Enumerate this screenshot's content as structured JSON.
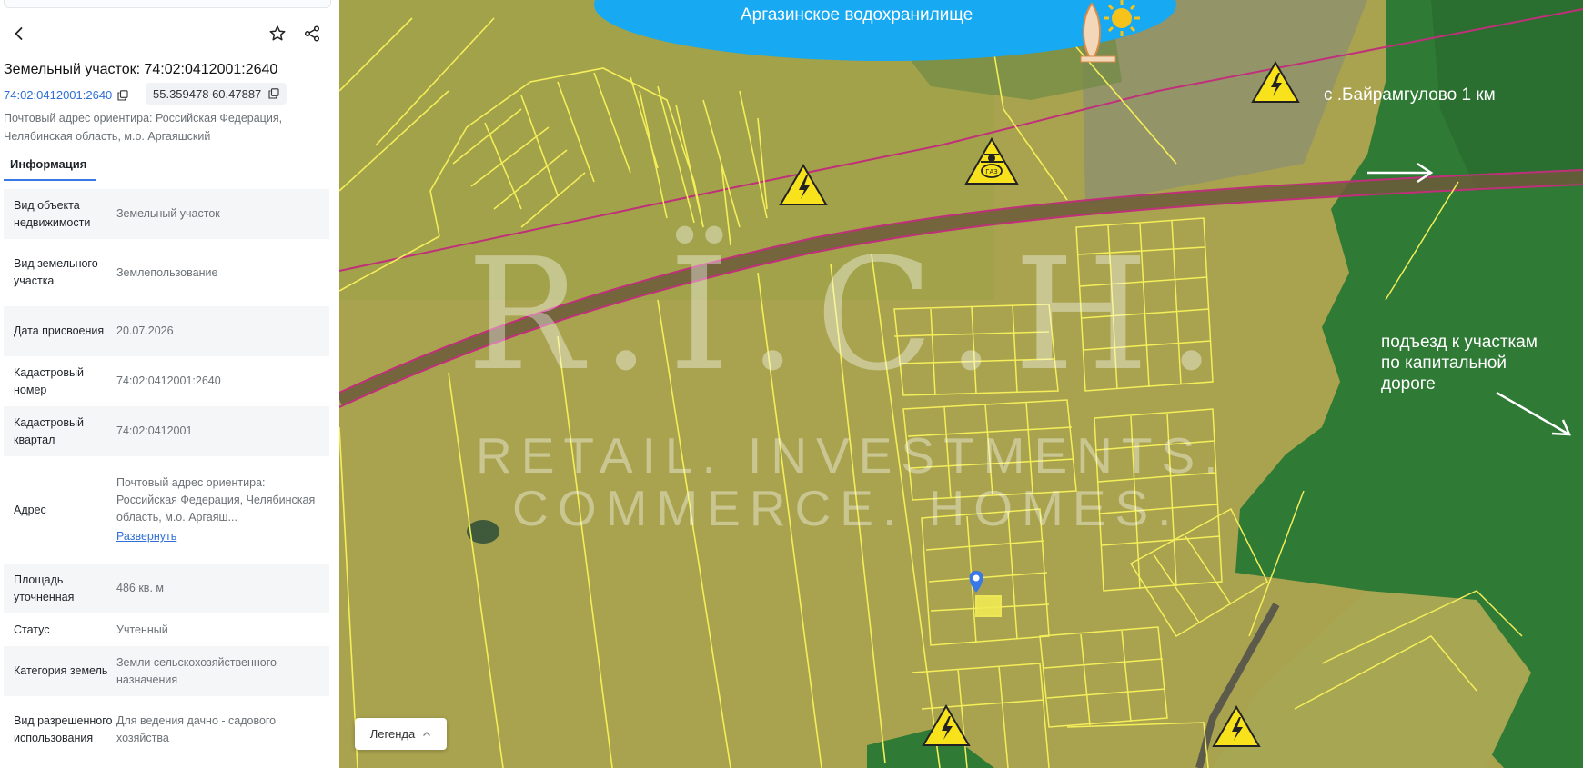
{
  "panel": {
    "title": "Земельный участок: 74:02:0412001:2640",
    "cadastral_link": "74:02:0412001:2640",
    "coords": "55.359478 60.47887",
    "address": "Почтовый адрес ориентира: Российская Федерация, Челябинская область, м.о. Аргаяшский",
    "tab_info": "Информация",
    "rows": [
      {
        "key": "Вид объекта недвижимости",
        "value": "Земельный участок"
      },
      {
        "key": "Вид земельного участка",
        "value": "Землепользование"
      },
      {
        "key": "Дата присвоения",
        "value": "20.07.2026"
      },
      {
        "key": "Кадастровый номер",
        "value": "74:02:0412001:2640"
      },
      {
        "key": "Кадастровый квартал",
        "value": "74:02:0412001"
      },
      {
        "key": "Адрес",
        "value": "Почтовый адрес ориентира: Российская Федерация, Челябинская область, м.о. Аргаяш...",
        "link": "Развернуть"
      },
      {
        "key": "Площадь уточненная",
        "value": "486 кв. м"
      },
      {
        "key": "Статус",
        "value": "Учтенный"
      },
      {
        "key": "Категория земель",
        "value": "Земли сельскохозяйственного назначения"
      },
      {
        "key": "Вид разрешенного использования",
        "value": "Для ведения дачно - садового хозяйства"
      }
    ]
  },
  "map": {
    "reservoir_label": "Аргазинское водохранилище",
    "village_label": "с .Байрамгулово 1 км",
    "road_label": "подъезд к участкам\nпо капитальной\nдороге",
    "legend_label": "Легенда",
    "watermark_logo": "R.Ï.C.H.",
    "watermark_line1": "RETAIL. INVESTMENTS.",
    "watermark_line2": "COMMERCE. HOMES.",
    "gas_sign_text": "ГАЗ",
    "colors": {
      "field": "#a8a24e",
      "forest": "#2f7a35",
      "banner": "#17a9f2",
      "plot_lines": "#f4ee5a",
      "power_line": "#c0307a",
      "road": "#6c5a3a",
      "marker": "#3b78e7"
    }
  },
  "icons": {
    "back": "chevron-left-icon",
    "star": "star-icon",
    "share": "share-icon",
    "copy": "copy-icon",
    "warning": "high-voltage-warning-icon",
    "gas": "gas-warning-icon",
    "pin": "location-pin-icon",
    "sun": "sun-icon",
    "surfboard": "surfboard-icon"
  }
}
